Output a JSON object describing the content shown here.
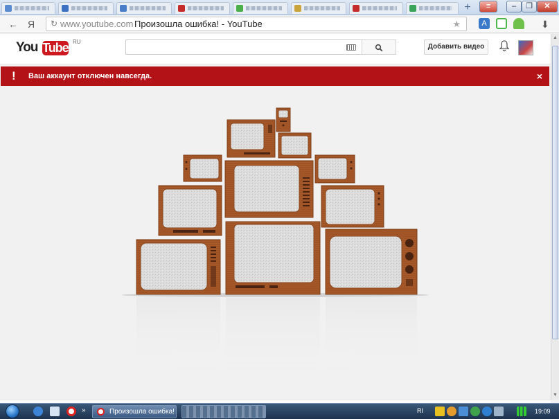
{
  "browser": {
    "newtab_label": "+",
    "nav": {
      "back": "←",
      "yandex": "Я"
    },
    "omnibox": {
      "reload": "↻",
      "domain": "www.youtube.com",
      "title": "Произошла ошибка! - YouTube",
      "star": "★"
    },
    "window_buttons": {
      "minimize": "–",
      "maximize": "❐",
      "close": "✕"
    }
  },
  "youtube": {
    "logo": {
      "you": "You",
      "tube": "Tube",
      "country": "RU"
    },
    "search": {
      "value": "",
      "button_icon": "search-icon"
    },
    "upload_label": "Добавить видео",
    "notifications_icon": "bell-icon"
  },
  "alert": {
    "icon": "!",
    "message": "Ваш аккаунт отключен навсегда.",
    "close": "×"
  },
  "taskbar": {
    "active_task": "Произошла ошибка! ...",
    "overflow": "»",
    "language": "RI",
    "clock": "19:09"
  },
  "colors": {
    "alert": "#b31217",
    "youtube_red": "#cc181e",
    "tv_wood": "#a75a2b",
    "tv_screen": "#dcdcdc",
    "page_bg": "#f1f1f1"
  }
}
